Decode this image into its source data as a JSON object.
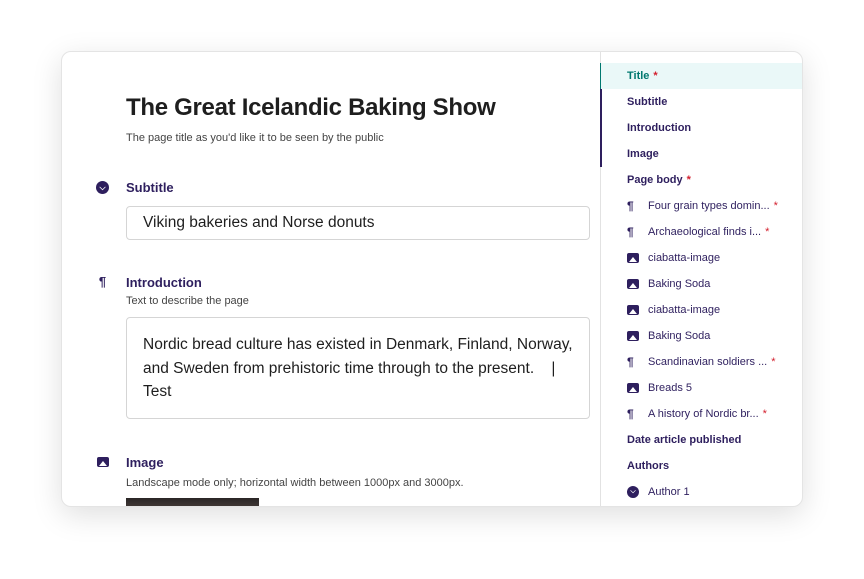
{
  "page": {
    "title": "The Great Icelandic Baking Show",
    "title_help": "The page title as you'd like it to be seen by the public"
  },
  "fields": {
    "subtitle": {
      "label": "Subtitle",
      "value": "Viking bakeries and Norse donuts",
      "icon": "chevron-down-circle-icon"
    },
    "introduction": {
      "label": "Introduction",
      "help": "Text to describe the page",
      "value_line1": "Nordic bread culture has existed in Denmark, Finland, Norway,",
      "value_line2": "and Sweden from prehistoric time through to the present.    |",
      "value_line3": "Test",
      "icon": "pilcrow-icon"
    },
    "image": {
      "label": "Image",
      "help": "Landscape mode only; horizontal width between 1000px and 3000px.",
      "icon": "image-icon"
    }
  },
  "sidebar": {
    "items": [
      {
        "label": "Title",
        "required": "*"
      },
      {
        "label": "Subtitle"
      },
      {
        "label": "Introduction"
      },
      {
        "label": "Image"
      },
      {
        "label": "Page body",
        "required": "*"
      },
      {
        "label": "Four grain types domin...",
        "required": "*",
        "icon": "pilcrow-icon"
      },
      {
        "label": "Archaeological finds i...",
        "required": "*",
        "icon": "pilcrow-icon"
      },
      {
        "label": "ciabatta-image",
        "icon": "image-icon"
      },
      {
        "label": "Baking Soda",
        "icon": "image-icon"
      },
      {
        "label": "ciabatta-image",
        "icon": "image-icon"
      },
      {
        "label": "Baking Soda",
        "icon": "image-icon"
      },
      {
        "label": "Scandinavian soldiers ...",
        "required": "*",
        "icon": "pilcrow-icon"
      },
      {
        "label": "Breads 5",
        "icon": "image-icon"
      },
      {
        "label": "A history of Nordic br...",
        "required": "*",
        "icon": "pilcrow-icon"
      },
      {
        "label": "Date article published"
      },
      {
        "label": "Authors"
      },
      {
        "label": "Author 1",
        "icon": "chevron-down-circle-icon"
      }
    ]
  },
  "colors": {
    "accent": "#00786f",
    "primary": "#2e1f5e",
    "required": "#d3202e",
    "active_bg": "#eaf8f8"
  }
}
